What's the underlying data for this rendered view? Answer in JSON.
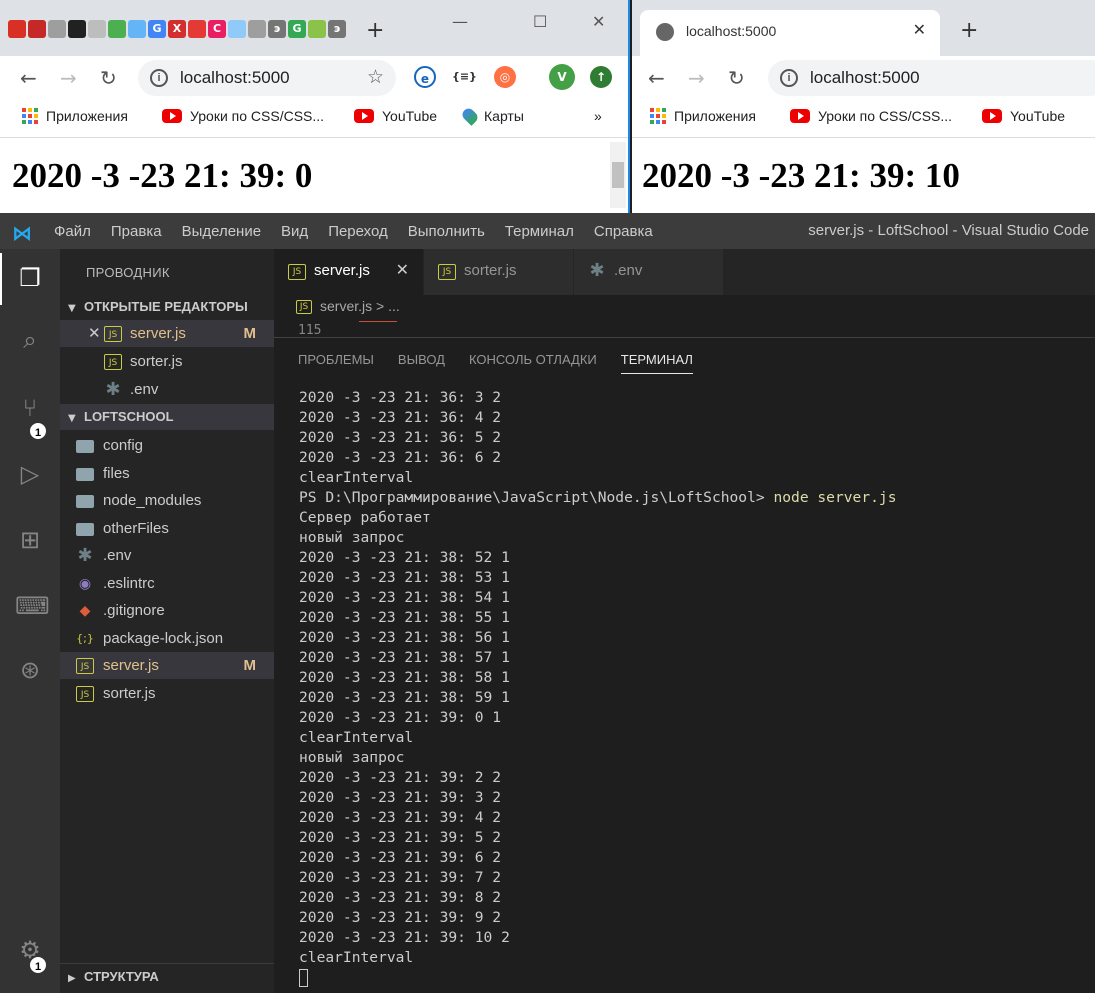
{
  "left_browser": {
    "tab_favicons": [
      {
        "icon": "favicon-red-icon",
        "char": "",
        "color": "#d93025"
      },
      {
        "icon": "favicon-red-icon",
        "char": "",
        "color": "#c62828"
      },
      {
        "icon": "favicon-doc-icon",
        "char": "",
        "color": "#9e9e9e"
      },
      {
        "icon": "favicon-dark-icon",
        "char": "",
        "color": "#212121"
      },
      {
        "icon": "favicon-doc-icon",
        "char": "",
        "color": "#bdbdbd"
      },
      {
        "icon": "favicon-green-icon",
        "char": "",
        "color": "#4caf50"
      },
      {
        "icon": "favicon-blue-icon",
        "char": "",
        "color": "#64b5f6"
      },
      {
        "icon": "favicon-google-icon",
        "char": "G",
        "color": "#4285f4"
      },
      {
        "icon": "favicon-x-icon",
        "char": "X",
        "color": "#d32f2f"
      },
      {
        "icon": "favicon-youtube-icon",
        "char": "",
        "color": "#e53935"
      },
      {
        "icon": "favicon-c-icon",
        "char": "C",
        "color": "#e91e63"
      },
      {
        "icon": "favicon-blue-icon",
        "char": "",
        "color": "#90caf9"
      },
      {
        "icon": "favicon-doc-icon",
        "char": "",
        "color": "#9e9e9e"
      },
      {
        "icon": "favicon-ex-icon",
        "char": "э",
        "color": "#757575"
      },
      {
        "icon": "favicon-google-icon",
        "char": "G",
        "color": "#34a853"
      },
      {
        "icon": "favicon-android-icon",
        "char": "",
        "color": "#8bc34a"
      },
      {
        "icon": "favicon-ex-icon",
        "char": "э",
        "color": "#757575"
      }
    ],
    "url": "localhost:5000",
    "page_time": "2020 -3 -23 21: 39: 0"
  },
  "right_browser": {
    "tab_title": "localhost:5000",
    "url": "localhost:5000",
    "page_time": "2020 -3 -23 21: 39: 10"
  },
  "bookmarks": {
    "apps": "Приложения",
    "css": "Уроки по CSS/CSS...",
    "youtube": "YouTube",
    "maps": "Карты",
    "more": "»"
  },
  "vscode": {
    "menu": [
      "Файл",
      "Правка",
      "Выделение",
      "Вид",
      "Переход",
      "Выполнить",
      "Терминал",
      "Справка"
    ],
    "window_title": "server.js - LoftSchool - Visual Studio Code",
    "explorer_title": "ПРОВОДНИК",
    "open_editors_title": "ОТКРЫТЫЕ РЕДАКТОРЫ",
    "open_editors": [
      {
        "name": "server.js",
        "modified": "M"
      },
      {
        "name": "sorter.js"
      },
      {
        "name": ".env"
      }
    ],
    "project_title": "LOFTSCHOOL",
    "files": [
      {
        "name": "config",
        "type": "folder"
      },
      {
        "name": "files",
        "type": "folder"
      },
      {
        "name": "node_modules",
        "type": "folder"
      },
      {
        "name": "otherFiles",
        "type": "folder"
      },
      {
        "name": ".env",
        "type": "env"
      },
      {
        "name": ".eslintrc",
        "type": "eslint"
      },
      {
        "name": ".gitignore",
        "type": "git"
      },
      {
        "name": "package-lock.json",
        "type": "json"
      },
      {
        "name": "server.js",
        "type": "js",
        "modified": "M"
      },
      {
        "name": "sorter.js",
        "type": "js"
      }
    ],
    "outline_title": "СТРУКТУРА",
    "editor_tabs": [
      "server.js",
      "sorter.js",
      ".env"
    ],
    "breadcrumb": "server.js > ...",
    "line_number": "115",
    "panel_tabs": [
      "ПРОБЛЕМЫ",
      "ВЫВОД",
      "КОНСОЛЬ ОТЛАДКИ",
      "ТЕРМИНАЛ"
    ],
    "scm_badge": "1",
    "settings_badge": "1",
    "terminal": {
      "before_prompt": [
        "2020 -3 -23 21: 36: 3 2",
        "2020 -3 -23 21: 36: 4 2",
        "2020 -3 -23 21: 36: 5 2",
        "2020 -3 -23 21: 36: 6 2",
        "clearInterval"
      ],
      "prompt": "PS D:\\Программирование\\JavaScript\\Node.js\\LoftSchool> ",
      "command": "node server.js",
      "after_prompt": [
        "Сервер работает",
        "новый запрос",
        "2020 -3 -23 21: 38: 52 1",
        "2020 -3 -23 21: 38: 53 1",
        "2020 -3 -23 21: 38: 54 1",
        "2020 -3 -23 21: 38: 55 1",
        "2020 -3 -23 21: 38: 56 1",
        "2020 -3 -23 21: 38: 57 1",
        "2020 -3 -23 21: 38: 58 1",
        "2020 -3 -23 21: 38: 59 1",
        "2020 -3 -23 21: 39: 0 1",
        "clearInterval",
        "новый запрос",
        "2020 -3 -23 21: 39: 2 2",
        "2020 -3 -23 21: 39: 3 2",
        "2020 -3 -23 21: 39: 4 2",
        "2020 -3 -23 21: 39: 5 2",
        "2020 -3 -23 21: 39: 6 2",
        "2020 -3 -23 21: 39: 7 2",
        "2020 -3 -23 21: 39: 8 2",
        "2020 -3 -23 21: 39: 9 2",
        "2020 -3 -23 21: 39: 10 2",
        "clearInterval"
      ]
    }
  }
}
